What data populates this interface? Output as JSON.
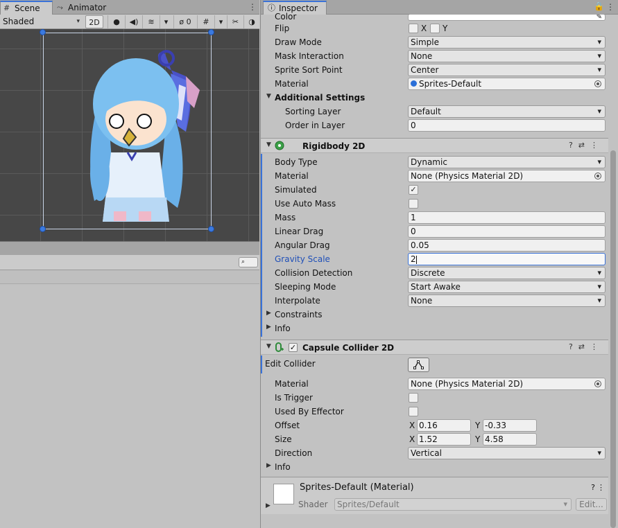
{
  "scene": {
    "tabs": [
      {
        "label": "Scene"
      },
      {
        "label": "Animator"
      }
    ],
    "shading_mode": "Shaded",
    "mode_2d": "2D",
    "hidden_count": "0"
  },
  "inspector": {
    "tab_label": "Inspector",
    "sprite_renderer": {
      "color_label": "Color",
      "flip_label": "Flip",
      "flip_x": "X",
      "flip_y": "Y",
      "draw_mode": {
        "label": "Draw Mode",
        "value": "Simple"
      },
      "mask_interaction": {
        "label": "Mask Interaction",
        "value": "None"
      },
      "sprite_sort_point": {
        "label": "Sprite Sort Point",
        "value": "Center"
      },
      "material": {
        "label": "Material",
        "value": "Sprites-Default"
      },
      "additional_settings": "Additional Settings",
      "sorting_layer": {
        "label": "Sorting Layer",
        "value": "Default"
      },
      "order_in_layer": {
        "label": "Order in Layer",
        "value": "0"
      }
    },
    "rigidbody": {
      "title": "Rigidbody 2D",
      "body_type": {
        "label": "Body Type",
        "value": "Dynamic"
      },
      "material": {
        "label": "Material",
        "value": "None (Physics Material 2D)"
      },
      "simulated": {
        "label": "Simulated",
        "value": "✓"
      },
      "use_auto_mass": {
        "label": "Use Auto Mass"
      },
      "mass": {
        "label": "Mass",
        "value": "1"
      },
      "linear_drag": {
        "label": "Linear Drag",
        "value": "0"
      },
      "angular_drag": {
        "label": "Angular Drag",
        "value": "0.05"
      },
      "gravity_scale": {
        "label": "Gravity Scale",
        "value": "2"
      },
      "collision_detection": {
        "label": "Collision Detection",
        "value": "Discrete"
      },
      "sleeping_mode": {
        "label": "Sleeping Mode",
        "value": "Start Awake"
      },
      "interpolate": {
        "label": "Interpolate",
        "value": "None"
      },
      "constraints": "Constraints",
      "info": "Info"
    },
    "capsule": {
      "title": "Capsule Collider 2D",
      "enabled": "✓",
      "edit_collider": "Edit Collider",
      "material": {
        "label": "Material",
        "value": "None (Physics Material 2D)"
      },
      "is_trigger": {
        "label": "Is Trigger"
      },
      "used_by_effector": {
        "label": "Used By Effector"
      },
      "offset": {
        "label": "Offset",
        "x_label": "X",
        "x": "0.16",
        "y_label": "Y",
        "y": "-0.33"
      },
      "size": {
        "label": "Size",
        "x_label": "X",
        "x": "1.52",
        "y_label": "Y",
        "y": "4.58"
      },
      "direction": {
        "label": "Direction",
        "value": "Vertical"
      },
      "info": "Info"
    },
    "material_footer": {
      "title": "Sprites-Default (Material)",
      "shader_label": "Shader",
      "shader_value": "Sprites/Default",
      "edit_label": "Edit..."
    }
  },
  "colors": {
    "accent": "#3a72d8",
    "panel": "#c2c2c2",
    "scene_bg": "#474747"
  }
}
